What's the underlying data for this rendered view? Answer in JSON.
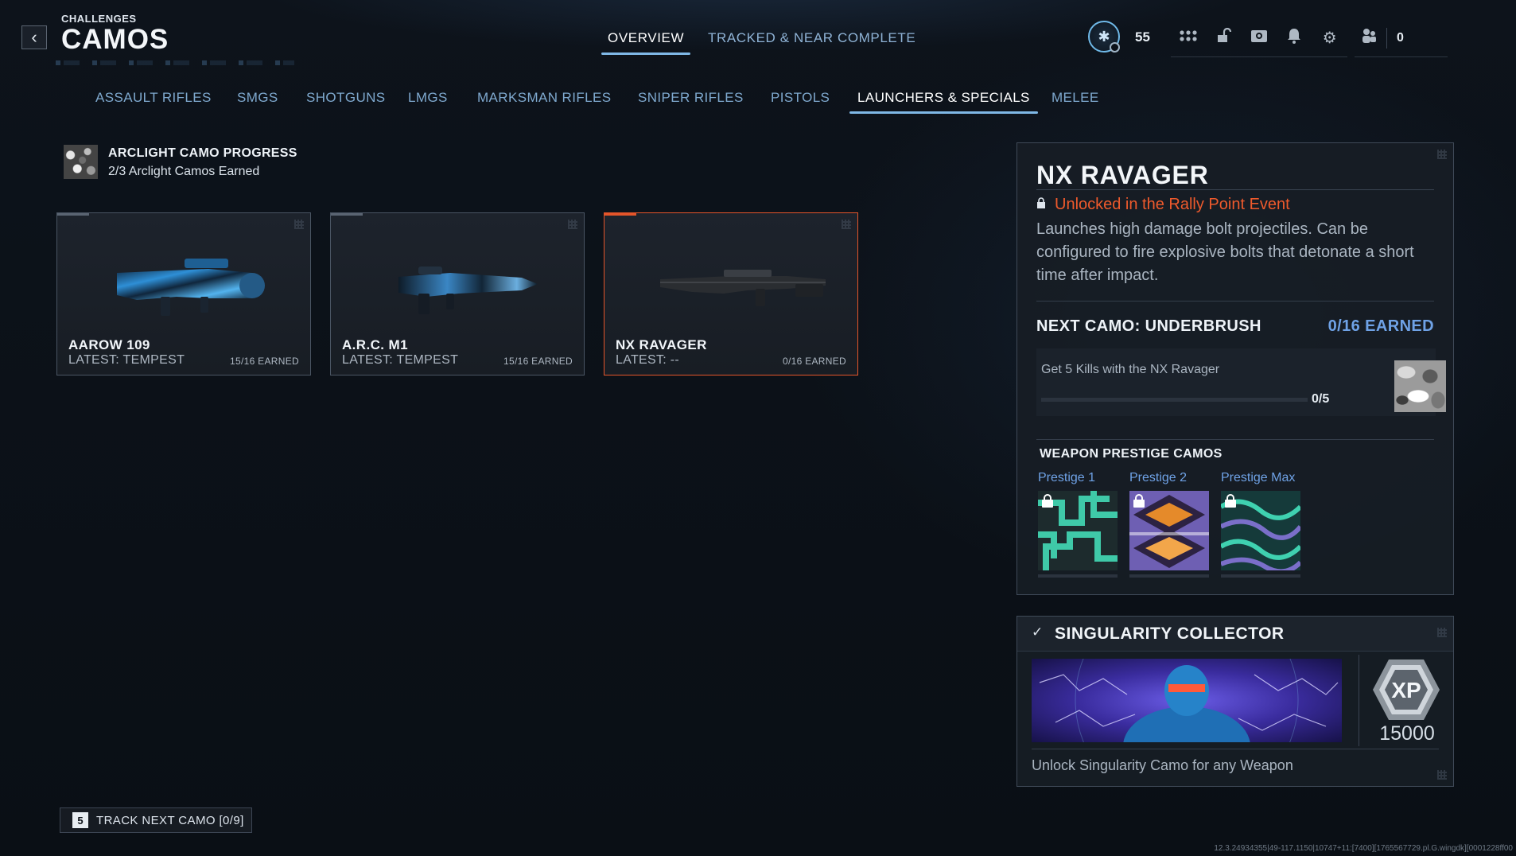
{
  "header": {
    "subtitle": "CHALLENGES",
    "title": "CAMOS"
  },
  "top_tabs": [
    {
      "label": "OVERVIEW",
      "active": true
    },
    {
      "label": "TRACKED & NEAR COMPLETE",
      "active": false
    }
  ],
  "player": {
    "rank": "55",
    "friends_online": "0"
  },
  "icons": [
    "rank-emblem-icon",
    "menu-grid-icon",
    "unlock-icon",
    "photo-icon",
    "bell-icon",
    "gear-icon",
    "friends-icon"
  ],
  "categories": [
    {
      "label": "ASSAULT RIFLES",
      "active": false
    },
    {
      "label": "SMGS",
      "active": false
    },
    {
      "label": "SHOTGUNS",
      "active": false
    },
    {
      "label": "LMGS",
      "active": false
    },
    {
      "label": "MARKSMAN RIFLES",
      "active": false
    },
    {
      "label": "SNIPER RIFLES",
      "active": false
    },
    {
      "label": "PISTOLS",
      "active": false
    },
    {
      "label": "LAUNCHERS & SPECIALS",
      "active": true
    },
    {
      "label": "MELEE",
      "active": false
    }
  ],
  "arclight": {
    "title": "ARCLIGHT CAMO PROGRESS",
    "subtitle": "2/3 Arclight Camos Earned"
  },
  "weapons": [
    {
      "name": "AAROW 109",
      "latest": "LATEST: TEMPEST",
      "earned": "15/16 EARNED",
      "selected": false
    },
    {
      "name": "A.R.C. M1",
      "latest": "LATEST: TEMPEST",
      "earned": "15/16 EARNED",
      "selected": false
    },
    {
      "name": "NX RAVAGER",
      "latest": "LATEST: --",
      "earned": "0/16 EARNED",
      "selected": true
    }
  ],
  "detail": {
    "title": "NX RAVAGER",
    "unlock": "Unlocked in the Rally Point Event",
    "description": "Launches high damage bolt projectiles. Can be configured to fire explosive bolts that detonate a short time after impact.",
    "next_camo_label": "NEXT CAMO: UNDERBRUSH",
    "next_camo_earned": "0/16 EARNED",
    "challenge": {
      "text": "Get 5 Kills with the NX Ravager",
      "count": "0/5",
      "progress": 0
    },
    "prestige_title": "WEAPON PRESTIGE CAMOS",
    "prestige": [
      {
        "label": "Prestige 1"
      },
      {
        "label": "Prestige 2"
      },
      {
        "label": "Prestige Max"
      }
    ]
  },
  "singularity": {
    "title": "SINGULARITY COLLECTOR",
    "xp": "15000",
    "description": "Unlock Singularity Camo for any Weapon"
  },
  "footer": {
    "track_key": "5",
    "track_label": "TRACK NEXT CAMO [0/9]",
    "build": "12.3.24934355|49-117.1150|10747+11:[7400][1765567729.pl.G.wingdk][0001228ff00"
  },
  "colors": {
    "accent_blue": "#7fb8e6",
    "earned_blue": "#6fa2e6",
    "selected_orange": "#e4552a",
    "unlock_red": "#ef5a2c"
  }
}
